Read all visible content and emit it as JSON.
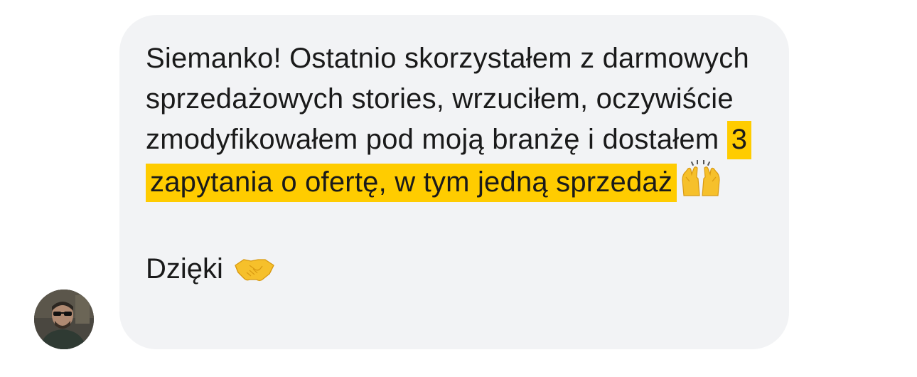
{
  "message": {
    "text_before_highlight": "Siemanko! Ostatnio skorzystałem z darmowych sprzedażowych stories, wrzuciłem, oczywiście zmodyfikowałem pod moją branżę i dostałem",
    "highlighted_text": "3 zapytania o ofertę, w tym jedną sprzedaż",
    "highlight_emoji_name": "raising-hands-icon",
    "closing_text": "Dzięki",
    "closing_emoji_name": "handshake-icon"
  },
  "colors": {
    "bubble_background": "#f2f3f5",
    "highlight": "#ffcc00",
    "text": "#1a1a1a"
  }
}
